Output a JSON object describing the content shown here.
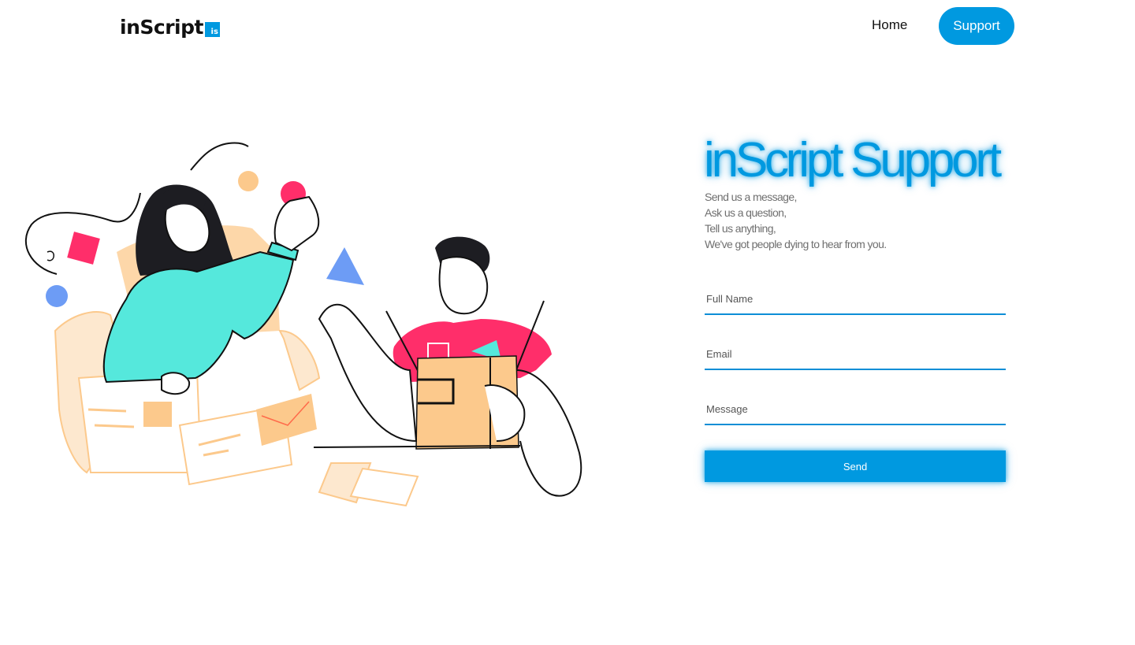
{
  "header": {
    "logo_text": "inScript",
    "logo_badge": "is",
    "nav": {
      "home_label": "Home",
      "support_label": "Support"
    }
  },
  "main": {
    "title": "inScript Support",
    "subtitle_lines": [
      "Send us a message,",
      "Ask us a question,",
      "Tell us anything,",
      "We've got people dying to hear from you."
    ],
    "form": {
      "full_name_placeholder": "Full Name",
      "email_placeholder": "Email",
      "message_placeholder": "Message",
      "send_label": "Send"
    }
  },
  "colors": {
    "accent": "#0099e0",
    "illustration_teal": "#55e8dc",
    "illustration_pink": "#ff2e6a",
    "illustration_peach": "#fcc98c",
    "illustration_blue": "#6d9cf5"
  },
  "illustration": {
    "icon": "support-illustration"
  }
}
